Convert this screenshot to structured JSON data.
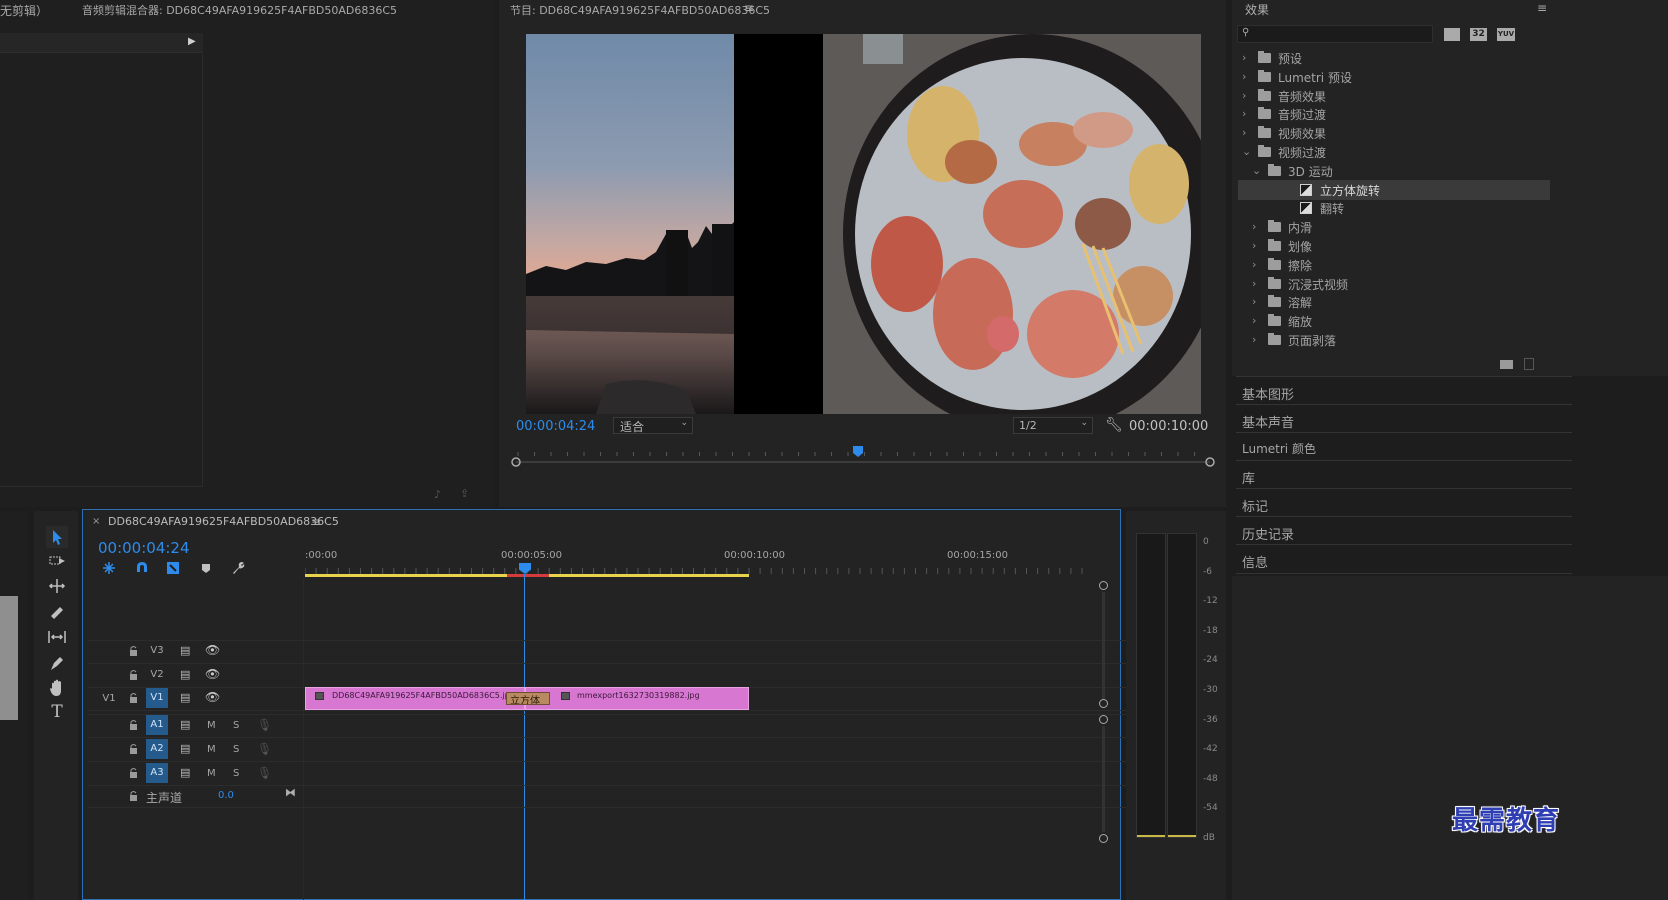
{
  "source_panel": {
    "tab1": "无剪辑）",
    "tab2": "音频剪辑混合器: DD68C49AFA919625F4AFBD50AD6836C5"
  },
  "program_monitor": {
    "title": "节目: DD68C49AFA919625F4AFBD50AD6836C5",
    "timecode": "00:00:04:24",
    "fit": "适合",
    "resolution": "1/2",
    "duration": "00:00:10:00"
  },
  "effects_panel": {
    "title": "效果",
    "search_placeholder": "",
    "badges": [
      "32",
      "YUV"
    ],
    "tree": [
      {
        "label": "预设",
        "level": 0,
        "kind": "folder",
        "state": "closed"
      },
      {
        "label": "Lumetri 预设",
        "level": 0,
        "kind": "folder",
        "state": "closed"
      },
      {
        "label": "音频效果",
        "level": 0,
        "kind": "folder",
        "state": "closed"
      },
      {
        "label": "音频过渡",
        "level": 0,
        "kind": "folder",
        "state": "closed"
      },
      {
        "label": "视频效果",
        "level": 0,
        "kind": "folder",
        "state": "closed"
      },
      {
        "label": "视频过渡",
        "level": 0,
        "kind": "folder",
        "state": "open"
      },
      {
        "label": "3D 运动",
        "level": 1,
        "kind": "folder",
        "state": "open"
      },
      {
        "label": "立方体旋转",
        "level": 2,
        "kind": "effect",
        "selected": true
      },
      {
        "label": "翻转",
        "level": 2,
        "kind": "effect"
      },
      {
        "label": "内滑",
        "level": 1,
        "kind": "folder",
        "state": "closed"
      },
      {
        "label": "划像",
        "level": 1,
        "kind": "folder",
        "state": "closed"
      },
      {
        "label": "擦除",
        "level": 1,
        "kind": "folder",
        "state": "closed"
      },
      {
        "label": "沉浸式视频",
        "level": 1,
        "kind": "folder",
        "state": "closed"
      },
      {
        "label": "溶解",
        "level": 1,
        "kind": "folder",
        "state": "closed"
      },
      {
        "label": "缩放",
        "level": 1,
        "kind": "folder",
        "state": "closed"
      },
      {
        "label": "页面剥落",
        "level": 1,
        "kind": "folder",
        "state": "closed"
      }
    ]
  },
  "panels": {
    "essential_graphics": "基本图形",
    "essential_sound": "基本声音",
    "lumetri_color": "Lumetri 颜色",
    "libraries": "库",
    "markers": "标记",
    "history": "历史记录",
    "info": "信息"
  },
  "timeline": {
    "sequence_name": "DD68C49AFA919625F4AFBD50AD6836C5",
    "timecode": "00:00:04:24",
    "ruler": [
      ":00:00",
      "00:00:05:00",
      "00:00:10:00",
      "00:00:15:00"
    ],
    "tracks": {
      "v3": "V3",
      "v2": "V2",
      "v1_src": "V1",
      "v1": "V1",
      "a1": "A1",
      "a2": "A2",
      "a3": "A3",
      "m": "M",
      "s": "S",
      "master": "主声道",
      "master_value": "0.0"
    },
    "clip1": "DD68C49AFA919625F4AFBD50AD6836C5.jp",
    "transition": "立方体",
    "clip2": "mmexport1632730319882.jpg"
  },
  "meter": {
    "ticks": [
      "0",
      "-6",
      "-12",
      "-18",
      "-24",
      "-30",
      "-36",
      "-42",
      "-48",
      "-54",
      "dB"
    ]
  },
  "watermark": "最需教育",
  "colors": {
    "accent": "#2d8ceb",
    "clip": "#d777d2",
    "track_on": "#255b8c",
    "work_area": "#e8d34a"
  }
}
